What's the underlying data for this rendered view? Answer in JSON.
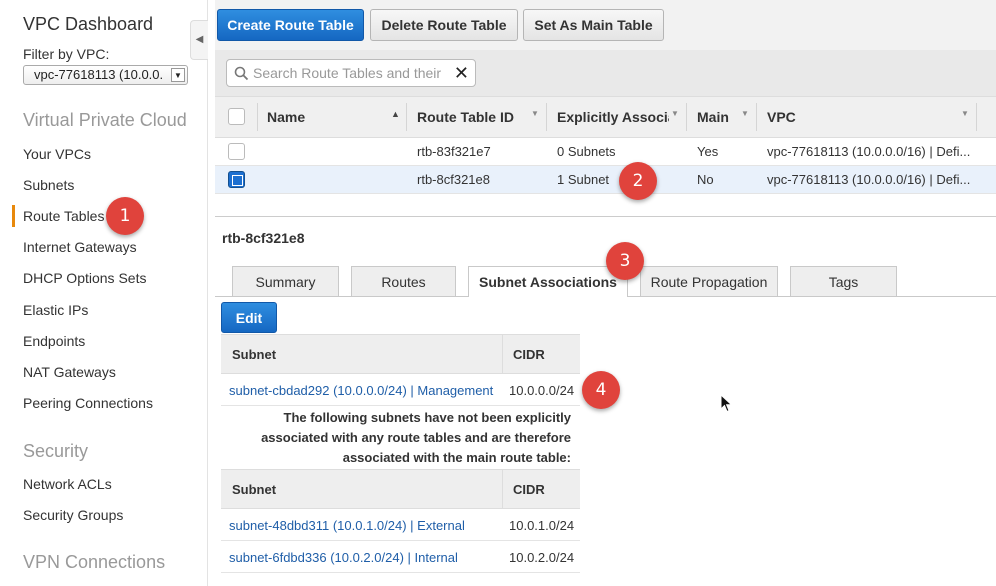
{
  "sidebar": {
    "title": "VPC Dashboard",
    "filter_label": "Filter by VPC:",
    "filter_value": "vpc-77618113 (10.0.0.",
    "sections": {
      "vpc": "Virtual Private Cloud",
      "security": "Security",
      "vpn": "VPN Connections"
    },
    "items": [
      {
        "label": "Your VPCs"
      },
      {
        "label": "Subnets"
      },
      {
        "label": "Route Tables"
      },
      {
        "label": "Internet Gateways"
      },
      {
        "label": "DHCP Options Sets"
      },
      {
        "label": "Elastic IPs"
      },
      {
        "label": "Endpoints"
      },
      {
        "label": "NAT Gateways"
      },
      {
        "label": "Peering Connections"
      }
    ],
    "security_items": [
      {
        "label": "Network ACLs"
      },
      {
        "label": "Security Groups"
      }
    ],
    "active_item": "Route Tables"
  },
  "toolbar": {
    "create": "Create Route Table",
    "delete": "Delete Route Table",
    "set_main": "Set As Main Table"
  },
  "search": {
    "placeholder": "Search Route Tables and their"
  },
  "table": {
    "headers": [
      "Name",
      "Route Table ID",
      "Explicitly Associat",
      "Main",
      "VPC"
    ],
    "rows": [
      {
        "name": "",
        "id": "rtb-83f321e7",
        "assoc": "0 Subnets",
        "main": "Yes",
        "vpc": "vpc-77618113 (10.0.0.0/16) | Defi...",
        "selected": false
      },
      {
        "name": "",
        "id": "rtb-8cf321e8",
        "assoc": "1 Subnet",
        "main": "No",
        "vpc": "vpc-77618113 (10.0.0.0/16) | Defi...",
        "selected": true
      }
    ]
  },
  "detail": {
    "title": "rtb-8cf321e8",
    "tabs": [
      "Summary",
      "Routes",
      "Subnet Associations",
      "Route Propagation",
      "Tags"
    ],
    "active_tab": "Subnet Associations",
    "edit": "Edit",
    "assoc_headers": [
      "Subnet",
      "CIDR"
    ],
    "assoc_rows": [
      {
        "subnet": "subnet-cbdad292 (10.0.0.0/24) | Management",
        "cidr": "10.0.0.0/24"
      }
    ],
    "note_lines": [
      "The following subnets have not been explicitly",
      "associated with any route tables and are therefore",
      "associated with the main route table:"
    ],
    "other_headers": [
      "Subnet",
      "CIDR"
    ],
    "other_rows": [
      {
        "subnet": "subnet-48dbd311 (10.0.1.0/24) | External",
        "cidr": "10.0.1.0/24"
      },
      {
        "subnet": "subnet-6fdbd336 (10.0.2.0/24) | Internal",
        "cidr": "10.0.2.0/24"
      }
    ]
  },
  "callouts": [
    "1",
    "2",
    "3",
    "4"
  ],
  "colors": {
    "primary": "#1567c2",
    "link": "#1f5ea8",
    "active_bar": "#e8890c",
    "badge": "#e0433c"
  }
}
